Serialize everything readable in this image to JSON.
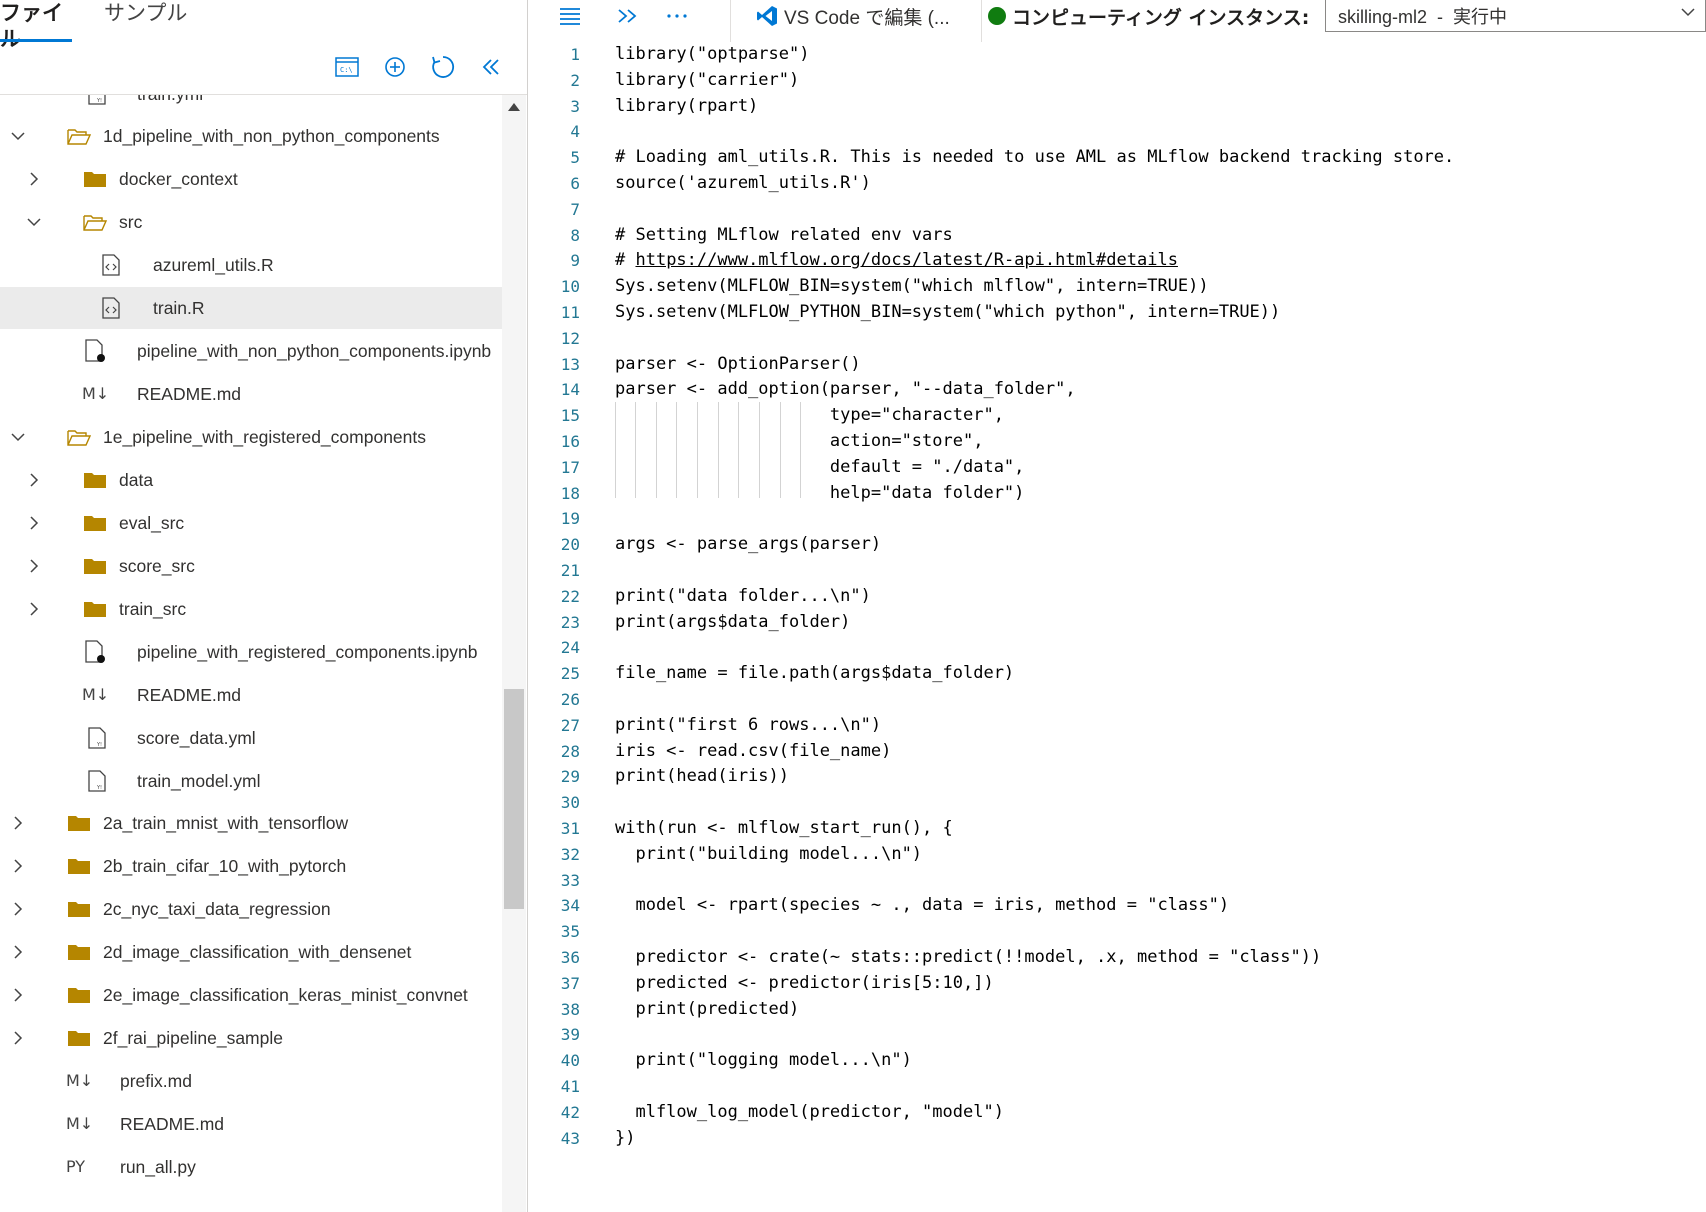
{
  "left": {
    "tabs": [
      {
        "label": "ファイル"
      },
      {
        "label": "サンプル"
      }
    ],
    "tree": [
      {
        "label": "train.yml",
        "icon": "yaml-file-icon"
      },
      {
        "label": "1d_pipeline_with_non_python_components",
        "icon": "open-folder-icon",
        "expanded": true
      },
      {
        "label": "docker_context",
        "icon": "folder-icon",
        "expanded": false
      },
      {
        "label": "src",
        "icon": "open-folder-icon",
        "expanded": true
      },
      {
        "label": "azureml_utils.R",
        "icon": "code-file-icon"
      },
      {
        "label": "train.R",
        "icon": "code-file-icon",
        "selected": true
      },
      {
        "label": "pipeline_with_non_python_components.ipynb",
        "icon": "notebook-file-icon"
      },
      {
        "label": "README.md",
        "icon": "markdown-file-icon",
        "icon_text": "M↓"
      },
      {
        "label": "1e_pipeline_with_registered_components",
        "icon": "open-folder-icon",
        "expanded": true
      },
      {
        "label": "data",
        "icon": "folder-icon",
        "expanded": false
      },
      {
        "label": "eval_src",
        "icon": "folder-icon",
        "expanded": false
      },
      {
        "label": "score_src",
        "icon": "folder-icon",
        "expanded": false
      },
      {
        "label": "train_src",
        "icon": "folder-icon",
        "expanded": false
      },
      {
        "label": "pipeline_with_registered_components.ipynb",
        "icon": "notebook-file-icon"
      },
      {
        "label": "README.md",
        "icon": "markdown-file-icon",
        "icon_text": "M↓"
      },
      {
        "label": "score_data.yml",
        "icon": "yaml-file-icon"
      },
      {
        "label": "train_model.yml",
        "icon": "yaml-file-icon"
      },
      {
        "label": "2a_train_mnist_with_tensorflow",
        "icon": "folder-icon",
        "expanded": false
      },
      {
        "label": "2b_train_cifar_10_with_pytorch",
        "icon": "folder-icon",
        "expanded": false
      },
      {
        "label": "2c_nyc_taxi_data_regression",
        "icon": "folder-icon",
        "expanded": false
      },
      {
        "label": "2d_image_classification_with_densenet",
        "icon": "folder-icon",
        "expanded": false
      },
      {
        "label": "2e_image_classification_keras_minist_convnet",
        "icon": "folder-icon",
        "expanded": false
      },
      {
        "label": "2f_rai_pipeline_sample",
        "icon": "folder-icon",
        "expanded": false
      },
      {
        "label": "prefix.md",
        "icon": "markdown-file-icon",
        "icon_text": "M↓"
      },
      {
        "label": "README.md",
        "icon": "markdown-file-icon",
        "icon_text": "M↓"
      },
      {
        "label": "run_all.py",
        "icon": "python-file-icon",
        "icon_text": "PY"
      }
    ]
  },
  "right": {
    "vscode_label": "VS Code で編集 (...",
    "compute_label": "コンピューティング インスタンス:",
    "compute_value": "skilling-ml2  -  実行中",
    "status_color": "#107c10"
  },
  "editor": {
    "lines": [
      "library(\"optparse\")",
      "library(\"carrier\")",
      "library(rpart)",
      "",
      "# Loading aml_utils.R. This is needed to use AML as MLflow backend tracking store.",
      "source('azureml_utils.R')",
      "",
      "# Setting MLflow related env vars",
      "# https://www.mlflow.org/docs/latest/R-api.html#details",
      "Sys.setenv(MLFLOW_BIN=system(\"which mlflow\", intern=TRUE))",
      "Sys.setenv(MLFLOW_PYTHON_BIN=system(\"which python\", intern=TRUE))",
      "",
      "parser <- OptionParser()",
      "parser <- add_option(parser, \"--data_folder\",",
      "                     type=\"character\",",
      "                     action=\"store\",",
      "                     default = \"./data\",",
      "                     help=\"data folder\")",
      "",
      "args <- parse_args(parser)",
      "",
      "print(\"data folder...\\n\")",
      "print(args$data_folder)",
      "",
      "file_name = file.path(args$data_folder)",
      "",
      "print(\"first 6 rows...\\n\")",
      "iris <- read.csv(file_name)",
      "print(head(iris))",
      "",
      "with(run <- mlflow_start_run(), {",
      "  print(\"building model...\\n\")",
      "",
      "  model <- rpart(species ~ ., data = iris, method = \"class\")",
      "",
      "  predictor <- crate(~ stats::predict(!!model, .x, method = \"class\"))",
      "  predicted <- predictor(iris[5:10,])",
      "  print(predicted)",
      "",
      "  print(\"logging model...\\n\")",
      "",
      "  mlflow_log_model(predictor, \"model\")",
      "})"
    ],
    "line_numbers": [
      "1",
      "2",
      "3",
      "4",
      "5",
      "6",
      "7",
      "8",
      "9",
      "10",
      "11",
      "12",
      "13",
      "14",
      "15",
      "16",
      "17",
      "18",
      "19",
      "20",
      "21",
      "22",
      "23",
      "24",
      "25",
      "26",
      "27",
      "28",
      "29",
      "30",
      "31",
      "32",
      "33",
      "34",
      "35",
      "36",
      "37",
      "38",
      "39",
      "40",
      "41",
      "42",
      "43"
    ]
  }
}
